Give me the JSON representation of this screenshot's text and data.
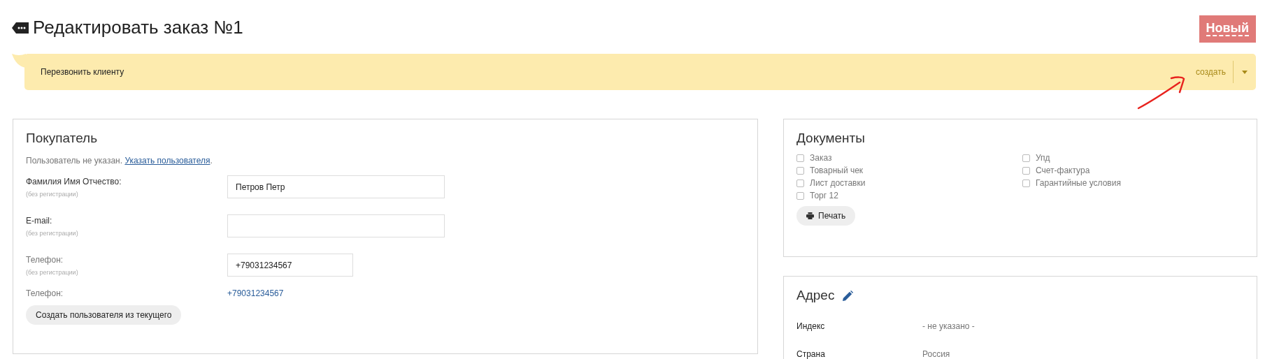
{
  "title": "Редактировать заказ №1",
  "status": "Новый",
  "reminder": {
    "text": "Перезвонить клиенту",
    "action": "создать"
  },
  "buyer": {
    "title": "Покупатель",
    "notice": "Пользователь не указан.",
    "notice_link": "Указать пользователя",
    "notice_end": ".",
    "fields": [
      {
        "kind": "input",
        "label": "Фамилия Имя Отчество:",
        "hint": "(без регистрации)",
        "value": "Петров Петр",
        "wide": true
      },
      {
        "kind": "input",
        "label": "E-mail:",
        "hint": "(без регистрации)",
        "wide": true
      },
      {
        "kind": "input",
        "label": "Телефон:",
        "hint": "(без регистрации)",
        "value": "+79031234567",
        "wide": false
      },
      {
        "kind": "link",
        "label": "Телефон:",
        "value": "+79031234567"
      }
    ],
    "button": "Создать пользователя из текущего"
  },
  "documents": {
    "title": "Документы",
    "columns": [
      [
        {
          "label": "Заказ",
          "checked": false
        },
        {
          "label": "Товарный чек",
          "checked": false
        },
        {
          "label": "Лист доставки",
          "checked": false
        },
        {
          "label": "Торг 12",
          "checked": false
        }
      ],
      [
        {
          "label": "Упд",
          "checked": false
        },
        {
          "label": "Счет-фактура",
          "checked": false
        },
        {
          "label": "Гарантийные условия",
          "checked": false
        }
      ]
    ],
    "button": "Печать"
  },
  "address": {
    "title": "Адрес",
    "rows": [
      {
        "label": "Индекс",
        "value": "- не указано -"
      },
      {
        "label": "Страна",
        "value": "Россия"
      }
    ]
  }
}
